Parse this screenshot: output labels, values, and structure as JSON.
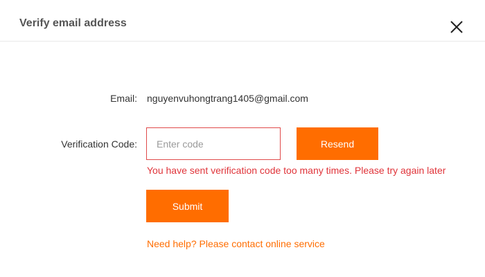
{
  "dialog": {
    "title": "Verify email address",
    "close_icon": "close-icon"
  },
  "form": {
    "email_label": "Email:",
    "email_value": "nguyenvuhongtrang1405@gmail.com",
    "code_label": "Verification Code:",
    "code_placeholder": "Enter code",
    "code_value": "",
    "resend_label": "Resend",
    "error_message": "You have sent verification code too many times. Please try again later",
    "submit_label": "Submit",
    "help_text": "Need help? Please contact online service"
  },
  "colors": {
    "accent": "#ff6d00",
    "error": "#e0343a",
    "error_border": "#e04a4a",
    "title_text": "#555555"
  }
}
